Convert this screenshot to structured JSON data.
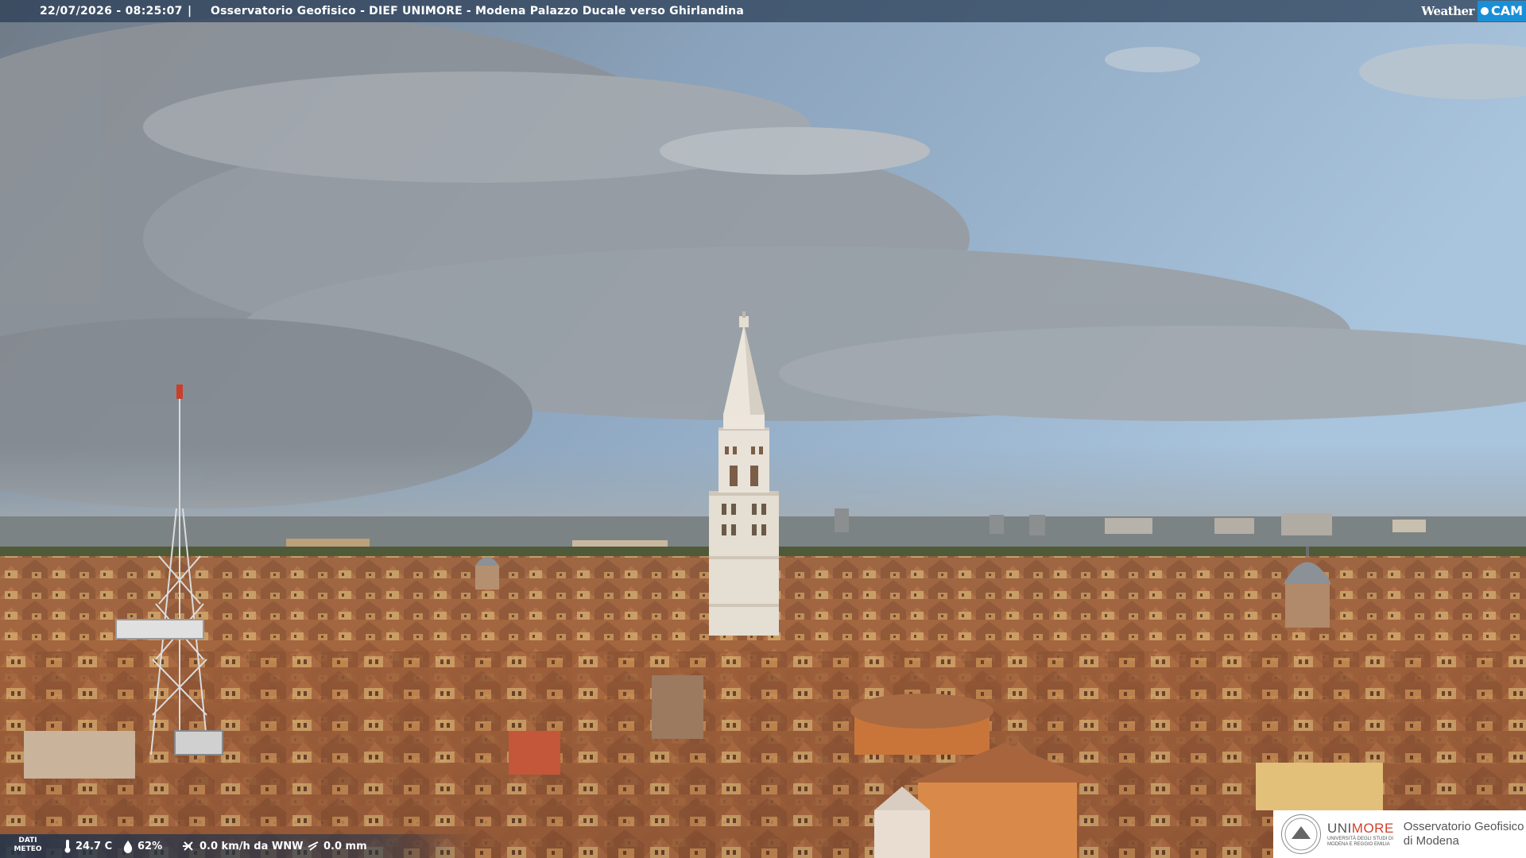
{
  "overlay": {
    "timestamp": "22/07/2026 - 08:25:07",
    "separator": "|",
    "title": "Osservatorio Geofisico - DIEF UNIMORE - Modena Palazzo Ducale verso Ghirlandina",
    "brand_weather": "Weather",
    "brand_cam": "CAM"
  },
  "meteo": {
    "label_line1": "DATI",
    "label_line2": "METEO",
    "temperature": "24.7 C",
    "humidity": "62%",
    "wind": "0.0 km/h da WNW",
    "rain": "0.0 mm"
  },
  "logo": {
    "uni_prefix": "UNI",
    "uni_suffix": "MORE",
    "uni_sub_line1": "UNIVERSITÀ DEGLI STUDI DI",
    "uni_sub_line2": "MODENA E REGGIO EMILIA",
    "observatory_line1": "Osservatorio Geofisico",
    "observatory_line2": "di Modena"
  },
  "colors": {
    "sky_top": "#7d9ab8",
    "sky_clear": "#a8c3dc",
    "clouds": "#8f9499",
    "roofs": "#a86a45",
    "tower": "#e8e2d8",
    "overlay_bar": "#283c55",
    "brand_blue": "#1a8fd6",
    "unimore_red": "#d0402a"
  },
  "icons": [
    "thermometer-icon",
    "humidity-drop-icon",
    "wind-icon",
    "rain-icon",
    "unimore-seal-icon"
  ]
}
